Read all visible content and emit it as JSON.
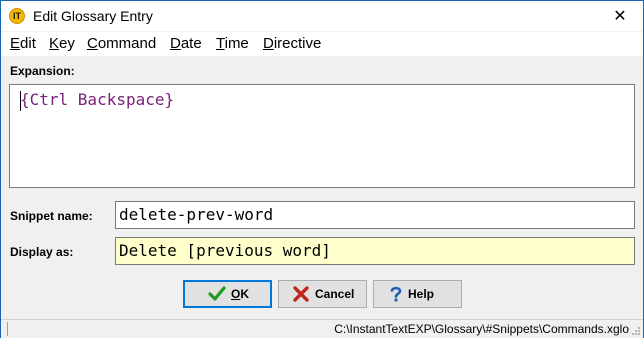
{
  "window": {
    "title": "Edit Glossary Entry",
    "close_glyph": "✕",
    "app_icon": "instanttext-logo-icon",
    "app_icon_text": "IT"
  },
  "menu": {
    "items": [
      {
        "underline": "E",
        "rest": "dit"
      },
      {
        "underline": "K",
        "rest": "ey"
      },
      {
        "underline": "C",
        "rest": "ommand"
      },
      {
        "underline": "D",
        "rest": "ate"
      },
      {
        "underline": "T",
        "rest": "ime"
      },
      {
        "underline": "D",
        "rest": "irective"
      }
    ]
  },
  "expansion": {
    "label": "Expansion:",
    "value": "{Ctrl Backspace}",
    "text_color": "#7a1f7a"
  },
  "snippet": {
    "label": "Snippet name:",
    "value": "delete-prev-word"
  },
  "display": {
    "label": "Display as:",
    "value": "Delete [previous word]",
    "background": "#ffffcc"
  },
  "buttons": {
    "ok_label": "OK",
    "ok_underline": "O",
    "ok_rest": "K",
    "ok_icon": "checkmark-icon",
    "cancel_label": "Cancel",
    "cancel_icon": "red-x-icon",
    "help_label": "Help",
    "help_icon": "question-mark-icon"
  },
  "status": {
    "path": "C:\\InstantTextEXP\\Glossary\\#Snippets\\Commands.xglo"
  }
}
